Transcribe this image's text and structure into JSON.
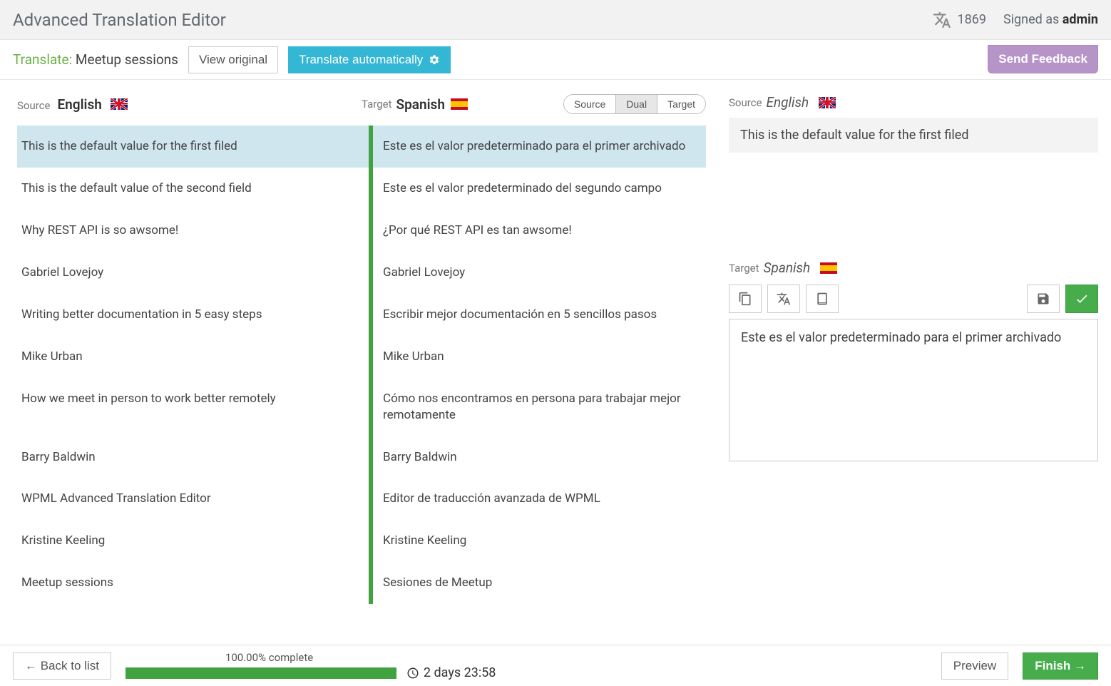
{
  "header": {
    "title": "Advanced Translation Editor",
    "word_count": "1869",
    "signed_as_prefix": "Signed as ",
    "signed_as_user": "admin"
  },
  "toolbar": {
    "translate_prefix": "Translate:",
    "job_title": "Meetup sessions",
    "view_original_label": "View original",
    "translate_auto_label": "Translate automatically",
    "feedback_label": "Send Feedback"
  },
  "left": {
    "source_label": "Source",
    "source_lang": "English",
    "target_label": "Target",
    "target_lang": "Spanish",
    "view_modes": {
      "source": "Source",
      "dual": "Dual",
      "target": "Target",
      "active": "dual"
    }
  },
  "rows": [
    {
      "src": "This is the default value for the first filed",
      "tgt": "Este es el valor predeterminado para el primer archivado",
      "selected": true
    },
    {
      "src": "This is the default value of the second field",
      "tgt": "Este es el valor predeterminado del segundo campo"
    },
    {
      "src": "Why REST API is so awsome!",
      "tgt": "¿Por qué REST API es tan awsome!"
    },
    {
      "src": "Gabriel Lovejoy",
      "tgt": "Gabriel Lovejoy"
    },
    {
      "src": "Writing better documentation in 5 easy steps",
      "tgt": "Escribir mejor documentación en 5 sencillos pasos"
    },
    {
      "src": "Mike Urban",
      "tgt": "Mike Urban"
    },
    {
      "src": "How we meet in person to work better remotely",
      "tgt": "Cómo nos encontramos en persona para trabajar mejor remotamente"
    },
    {
      "src": "Barry Baldwin",
      "tgt": "Barry Baldwin"
    },
    {
      "src": "WPML Advanced Translation Editor",
      "tgt": "Editor de traducción avanzada de WPML"
    },
    {
      "src": "Kristine Keeling",
      "tgt": "Kristine Keeling"
    },
    {
      "src": "Meetup sessions",
      "tgt": "Sesiones de Meetup"
    }
  ],
  "right": {
    "source_label": "Source",
    "source_lang": "English",
    "source_text": "This is the default value for the first filed",
    "target_label": "Target",
    "target_lang": "Spanish",
    "target_text": "Este es el valor predeterminado para el primer archivado"
  },
  "footer": {
    "back_label": "← Back to list",
    "progress_label": "100.00% complete",
    "time_remaining": "2 days 23:58",
    "preview_label": "Preview",
    "finish_label": "Finish →"
  }
}
